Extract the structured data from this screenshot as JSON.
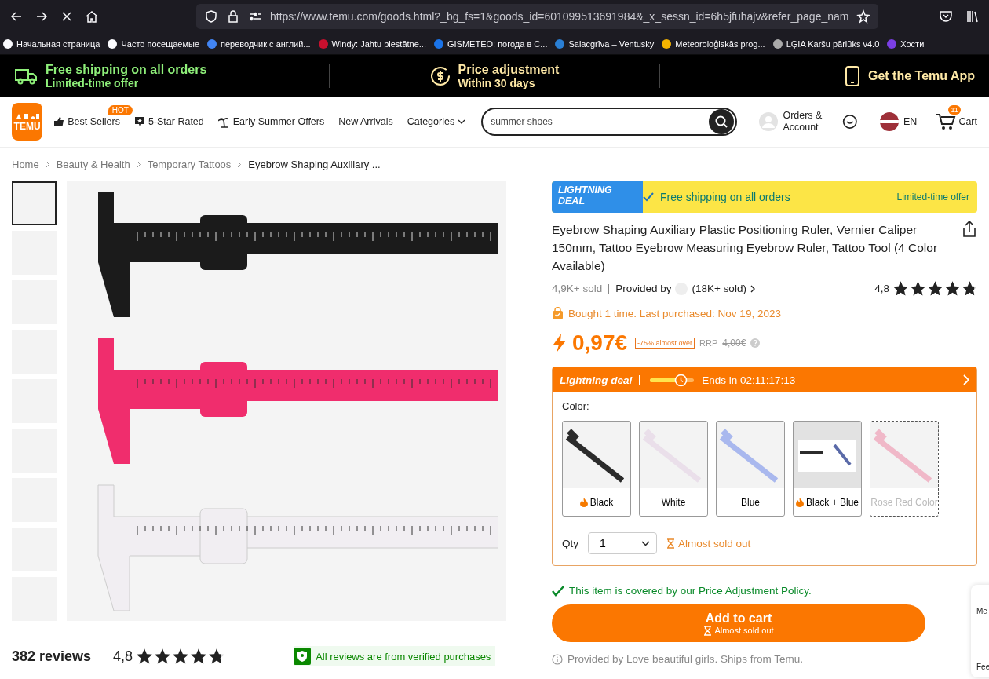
{
  "browser": {
    "url": "https://www.temu.com/goods.html?_bg_fs=1&goods_id=601099513691984&_x_sessn_id=6h5jfuhajv&refer_page_nam",
    "bookmarks": [
      "Начальная страница",
      "Часто посещаемые",
      "переводчик с англий...",
      "Windy: Jahtu piestātne...",
      "GISMETEO: погода в С...",
      "Salacgrīva – Ventusky",
      "Meteoroloģiskās prog...",
      "LĢIA Karšu pārlūks v4.0",
      "Хости"
    ]
  },
  "promo_bar": [
    {
      "kind": "shipping",
      "title": "Free shipping on all orders",
      "subtitle": "Limited-time offer"
    },
    {
      "kind": "price",
      "title": "Price adjustment",
      "subtitle": "Within 30 days"
    },
    {
      "kind": "app",
      "title": "Get the Temu App"
    }
  ],
  "header": {
    "logo": "TEMU",
    "nav": [
      {
        "kind": "thumb",
        "label": "Best Sellers",
        "badge": "HOT"
      },
      {
        "kind": "star",
        "label": "5-Star Rated"
      },
      {
        "kind": "palm",
        "label": "Early Summer Offers"
      },
      {
        "kind": "plain",
        "label": "New Arrivals"
      },
      {
        "kind": "menu",
        "label": "Categories"
      }
    ],
    "search": {
      "value": "summer shoes"
    },
    "account": "Orders & Account",
    "language": "EN",
    "cart": {
      "label": "Cart",
      "count": "11"
    }
  },
  "breadcrumb": [
    "Home",
    "Beauty & Health",
    "Temporary Tattoos",
    "Eyebrow Shaping Auxiliary ..."
  ],
  "gallery": {
    "thumbnails": [
      {
        "selected": true
      },
      {
        "selected": false
      },
      {
        "selected": false
      },
      {
        "selected": false
      },
      {
        "selected": false
      },
      {
        "selected": false
      },
      {
        "selected": false
      },
      {
        "selected": false
      },
      {
        "selected": false
      }
    ]
  },
  "reviews": {
    "count": "382 reviews",
    "rating": "4,8",
    "stars": 4.8,
    "verified": "All reviews are from verified purchases"
  },
  "product": {
    "deal_banner": {
      "badge": "LIGHTNING DEAL",
      "text": "Free shipping on all orders",
      "note": "Limited-time offer"
    },
    "title": "Eyebrow Shaping Auxiliary Plastic Positioning Ruler, Vernier Caliper 150mm, Tattoo Eyebrow Measuring Eyebrow Ruler, Tattoo Tool (4 Color Available)",
    "sold": "4,9K+ sold",
    "provider": "Provided by",
    "provider_sold": "(18K+ sold)",
    "rating": "4,8",
    "stars": 4.8,
    "purchase_note": "Bought 1 time. Last purchased: Nov 19, 2023",
    "price": "0,97€",
    "discount": "-75% almost over",
    "rrp_label": "RRP",
    "rrp": "4,00€"
  },
  "deal": {
    "title": "Lightning deal",
    "level": 0.7,
    "ends": "Ends in 02:11:17:13",
    "color_label": "Color:",
    "options": [
      {
        "label": "Black",
        "hot": true,
        "selected": false,
        "disabled": false,
        "color": "#2b2b2b"
      },
      {
        "label": "White",
        "hot": false,
        "selected": false,
        "disabled": false,
        "color": "#eadfea"
      },
      {
        "label": "Blue",
        "hot": false,
        "selected": false,
        "disabled": false,
        "color": "#a9b8ee"
      },
      {
        "label": "Black + Blue",
        "hot": true,
        "selected": false,
        "disabled": false,
        "color": "#5a6aa8"
      },
      {
        "label": "Rose Red Color",
        "hot": false,
        "selected": false,
        "disabled": true,
        "color": "#f0b8c8"
      }
    ],
    "qty_label": "Qty",
    "qty": "1",
    "stock": "Almost sold out"
  },
  "policy": "This item is covered by our Price Adjustment Policy.",
  "cart_button": {
    "label": "Add to cart",
    "note": "Almost sold out"
  },
  "shipping_note": "Provided by Love beautiful girls. Ships from Temu.",
  "side_widget": [
    "Me",
    "Fee"
  ]
}
